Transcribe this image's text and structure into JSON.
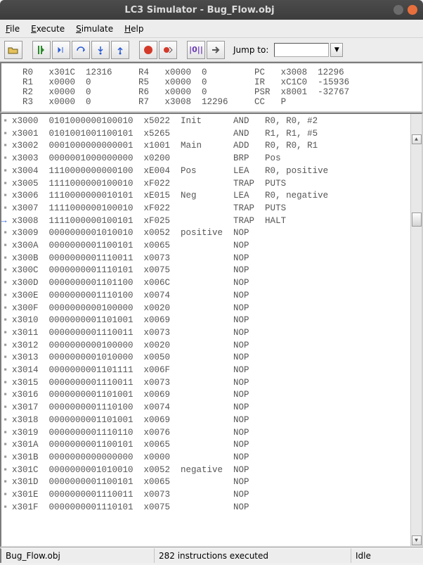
{
  "window": {
    "title": "LC3 Simulator - Bug_Flow.obj"
  },
  "menu": {
    "file": "File",
    "execute": "Execute",
    "simulate": "Simulate",
    "help": "Help"
  },
  "toolbar": {
    "jump_label": "Jump to:",
    "jump_value": "",
    "icons": {
      "open": "open-icon",
      "continue": "continue-icon",
      "step_back": "step-back-icon",
      "step_over": "step-over-icon",
      "step_into": "step-into-icon",
      "step_out": "step-out-icon",
      "run": "run-icon",
      "record": "record-icon",
      "breakpoint": "breakpoint-icon",
      "binary": "binary-icon",
      "go": "go-icon"
    }
  },
  "registers": {
    "R0": {
      "hex": "x301C",
      "dec": "12316"
    },
    "R1": {
      "hex": "x0000",
      "dec": "0"
    },
    "R2": {
      "hex": "x0000",
      "dec": "0"
    },
    "R3": {
      "hex": "x0000",
      "dec": "0"
    },
    "R4": {
      "hex": "x0000",
      "dec": "0"
    },
    "R5": {
      "hex": "x0000",
      "dec": "0"
    },
    "R6": {
      "hex": "x0000",
      "dec": "0"
    },
    "R7": {
      "hex": "x3008",
      "dec": "12296"
    },
    "PC": {
      "hex": "x3008",
      "dec": "12296"
    },
    "IR": {
      "hex": "xC1C0",
      "dec": "-15936"
    },
    "PSR": {
      "hex": "x8001",
      "dec": "-32767"
    },
    "CC": {
      "val": "P"
    }
  },
  "current_pc": "x3008",
  "memory": [
    {
      "addr": "x3000",
      "bin": "0101000000100010",
      "hex": "x5022",
      "label": "Init",
      "op": "AND",
      "args": "R0, R0, #2"
    },
    {
      "addr": "x3001",
      "bin": "0101001001100101",
      "hex": "x5265",
      "label": "",
      "op": "AND",
      "args": "R1, R1, #5"
    },
    {
      "addr": "x3002",
      "bin": "0001000000000001",
      "hex": "x1001",
      "label": "Main",
      "op": "ADD",
      "args": "R0, R0, R1"
    },
    {
      "addr": "x3003",
      "bin": "0000001000000000",
      "hex": "x0200",
      "label": "",
      "op": "BRP",
      "args": "Pos"
    },
    {
      "addr": "x3004",
      "bin": "1110000000000100",
      "hex": "xE004",
      "label": "Pos",
      "op": "LEA",
      "args": "R0, positive"
    },
    {
      "addr": "x3005",
      "bin": "1111000000100010",
      "hex": "xF022",
      "label": "",
      "op": "TRAP",
      "args": "PUTS"
    },
    {
      "addr": "x3006",
      "bin": "1110000000010101",
      "hex": "xE015",
      "label": "Neg",
      "op": "LEA",
      "args": "R0, negative"
    },
    {
      "addr": "x3007",
      "bin": "1111000000100010",
      "hex": "xF022",
      "label": "",
      "op": "TRAP",
      "args": "PUTS"
    },
    {
      "addr": "x3008",
      "bin": "1111000000100101",
      "hex": "xF025",
      "label": "",
      "op": "TRAP",
      "args": "HALT"
    },
    {
      "addr": "x3009",
      "bin": "0000000001010010",
      "hex": "x0052",
      "label": "positive",
      "op": "NOP",
      "args": ""
    },
    {
      "addr": "x300A",
      "bin": "0000000001100101",
      "hex": "x0065",
      "label": "",
      "op": "NOP",
      "args": ""
    },
    {
      "addr": "x300B",
      "bin": "0000000001110011",
      "hex": "x0073",
      "label": "",
      "op": "NOP",
      "args": ""
    },
    {
      "addr": "x300C",
      "bin": "0000000001110101",
      "hex": "x0075",
      "label": "",
      "op": "NOP",
      "args": ""
    },
    {
      "addr": "x300D",
      "bin": "0000000001101100",
      "hex": "x006C",
      "label": "",
      "op": "NOP",
      "args": ""
    },
    {
      "addr": "x300E",
      "bin": "0000000001110100",
      "hex": "x0074",
      "label": "",
      "op": "NOP",
      "args": ""
    },
    {
      "addr": "x300F",
      "bin": "0000000000100000",
      "hex": "x0020",
      "label": "",
      "op": "NOP",
      "args": ""
    },
    {
      "addr": "x3010",
      "bin": "0000000001101001",
      "hex": "x0069",
      "label": "",
      "op": "NOP",
      "args": ""
    },
    {
      "addr": "x3011",
      "bin": "0000000001110011",
      "hex": "x0073",
      "label": "",
      "op": "NOP",
      "args": ""
    },
    {
      "addr": "x3012",
      "bin": "0000000000100000",
      "hex": "x0020",
      "label": "",
      "op": "NOP",
      "args": ""
    },
    {
      "addr": "x3013",
      "bin": "0000000001010000",
      "hex": "x0050",
      "label": "",
      "op": "NOP",
      "args": ""
    },
    {
      "addr": "x3014",
      "bin": "0000000001101111",
      "hex": "x006F",
      "label": "",
      "op": "NOP",
      "args": ""
    },
    {
      "addr": "x3015",
      "bin": "0000000001110011",
      "hex": "x0073",
      "label": "",
      "op": "NOP",
      "args": ""
    },
    {
      "addr": "x3016",
      "bin": "0000000001101001",
      "hex": "x0069",
      "label": "",
      "op": "NOP",
      "args": ""
    },
    {
      "addr": "x3017",
      "bin": "0000000001110100",
      "hex": "x0074",
      "label": "",
      "op": "NOP",
      "args": ""
    },
    {
      "addr": "x3018",
      "bin": "0000000001101001",
      "hex": "x0069",
      "label": "",
      "op": "NOP",
      "args": ""
    },
    {
      "addr": "x3019",
      "bin": "0000000001110110",
      "hex": "x0076",
      "label": "",
      "op": "NOP",
      "args": ""
    },
    {
      "addr": "x301A",
      "bin": "0000000001100101",
      "hex": "x0065",
      "label": "",
      "op": "NOP",
      "args": ""
    },
    {
      "addr": "x301B",
      "bin": "0000000000000000",
      "hex": "x0000",
      "label": "",
      "op": "NOP",
      "args": ""
    },
    {
      "addr": "x301C",
      "bin": "0000000001010010",
      "hex": "x0052",
      "label": "negative",
      "op": "NOP",
      "args": ""
    },
    {
      "addr": "x301D",
      "bin": "0000000001100101",
      "hex": "x0065",
      "label": "",
      "op": "NOP",
      "args": ""
    },
    {
      "addr": "x301E",
      "bin": "0000000001110011",
      "hex": "x0073",
      "label": "",
      "op": "NOP",
      "args": ""
    },
    {
      "addr": "x301F",
      "bin": "0000000001110101",
      "hex": "x0075",
      "label": "",
      "op": "NOP",
      "args": ""
    }
  ],
  "status": {
    "file": "Bug_Flow.obj",
    "exec": "282 instructions executed",
    "state": "Idle"
  }
}
